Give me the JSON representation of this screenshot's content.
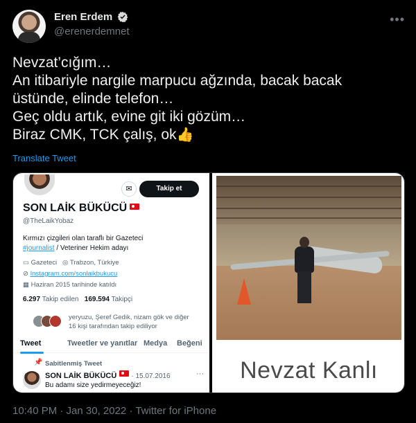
{
  "author": {
    "display_name": "Eren Erdem",
    "handle": "@erenerdemnet",
    "verified": true
  },
  "tweet": {
    "lines": [
      "Nevzat’cığım…",
      "An itibariyle nargile marpucu ağzında, bacak bacak",
      "üstünde, elinde telefon…",
      "Geç oldu artık, evine git iki gözüm…",
      "Biraz CMK, TCK çalış, ok"
    ],
    "emoji": "👍",
    "translate_label": "Translate Tweet"
  },
  "embedded_profile": {
    "follow_label": "Takip et",
    "name": "SON LAİK BÜKÜCÜ",
    "handle": "@TheLaikYobaz",
    "bio_line1": "Kırmızı çizgileri olan taraflı bir Gazeteci",
    "bio_hashtag": "#journalist",
    "bio_line2_rest": " / Veteriner Hekim adayı",
    "category": "Gazeteci",
    "location": "Trabzon, Türkiye",
    "website": "Instagram.com/sonlaikbukucu",
    "joined": "Haziran 2015 tarihinde katıldı",
    "following_count": "6.297",
    "following_label": "Takip edilen",
    "followers_count": "169.594",
    "followers_label": "Takipçi",
    "followed_by_line1": "yeryuzu, Şeref Gedik, nizam gök ve diğer",
    "followed_by_line2": "16 kişi tarafından takip ediliyor",
    "tabs": [
      "Tweet",
      "Tweetler ve yanıtlar",
      "Medya",
      "Beğeni"
    ],
    "pinned_label": "Sabitlenmiş Tweet",
    "pinned_name": "SON LAİK BÜKÜCÜ",
    "pinned_date": "· 15.07.2016",
    "pinned_text": "Bu adamı size yedirmeyeceğiz!"
  },
  "photo_caption": "Nevzat Kanlı",
  "footer": {
    "timestamp": "10:40 PM · Jan 30, 2022 · Twitter for iPhone"
  },
  "colors": {
    "background": "#000000",
    "link": "#1d9bf0",
    "muted": "#71767b"
  }
}
